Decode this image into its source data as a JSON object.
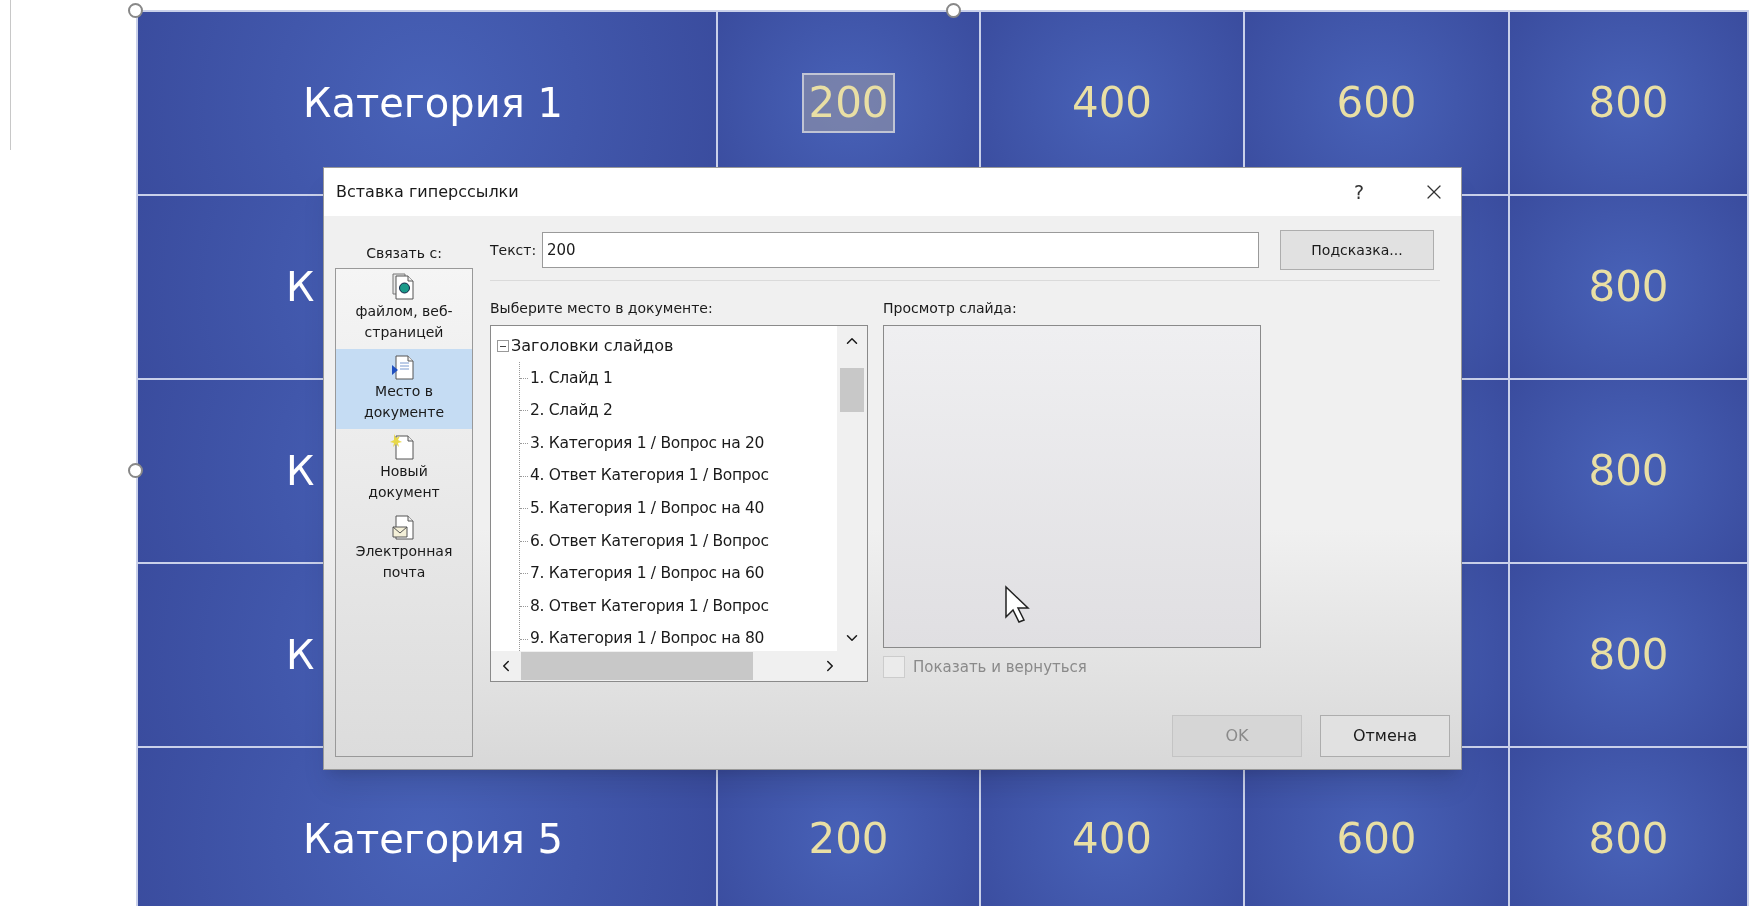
{
  "slide": {
    "rows": [
      {
        "category": "Категория 1",
        "values": [
          {
            "text": "200",
            "selected": true
          },
          {
            "text": "400",
            "selected": false
          },
          {
            "text": "600",
            "selected": false
          },
          {
            "text": "800",
            "selected": false
          }
        ]
      },
      {
        "category": "К",
        "values": [
          {
            "text": "800",
            "selected": false
          }
        ]
      },
      {
        "category": "К",
        "values": [
          {
            "text": "800",
            "selected": false
          }
        ]
      },
      {
        "category": "К",
        "values": [
          {
            "text": "800",
            "selected": false
          }
        ]
      },
      {
        "category": "Категория 5",
        "values": [
          {
            "text": "200",
            "selected": false
          },
          {
            "text": "400",
            "selected": false
          },
          {
            "text": "600",
            "selected": false
          },
          {
            "text": "800",
            "selected": false
          }
        ]
      }
    ]
  },
  "dialog": {
    "title": "Вставка гиперссылки",
    "help": "?",
    "link_to": {
      "label": "Связать с:",
      "items": [
        {
          "kind": "web",
          "label": "файлом, веб-страницей",
          "selected": false
        },
        {
          "kind": "place",
          "label": "Место в документе",
          "selected": true
        },
        {
          "kind": "new",
          "label": "Новый документ",
          "selected": false
        },
        {
          "kind": "email",
          "label": "Электронная почта",
          "selected": false
        }
      ]
    },
    "text_field": {
      "label": "Текст:",
      "value": "200"
    },
    "hint_button": "Подсказка...",
    "tree": {
      "label": "Выберите место в документе:",
      "root": {
        "label": "Заголовки слайдов",
        "expanded": true,
        "children": [
          {
            "label": "1. Слайд 1"
          },
          {
            "label": "2. Слайд 2"
          },
          {
            "label": "3. Категория 1 / Вопрос на 20"
          },
          {
            "label": "4. Ответ Категория 1 / Вопрос"
          },
          {
            "label": "5. Категория 1 / Вопрос на 40"
          },
          {
            "label": "6. Ответ Категория 1 / Вопрос"
          },
          {
            "label": "7. Категория 1 / Вопрос на 60"
          },
          {
            "label": "8. Ответ Категория 1 / Вопрос"
          },
          {
            "label": "9. Категория 1 / Вопрос на 80"
          }
        ]
      }
    },
    "preview": {
      "label": "Просмотр слайда:"
    },
    "checkbox": {
      "label": "Показать и вернуться",
      "checked": false,
      "disabled": true
    },
    "buttons": [
      {
        "label": "OK",
        "disabled": true
      },
      {
        "label": "Отмена",
        "disabled": false
      }
    ]
  }
}
